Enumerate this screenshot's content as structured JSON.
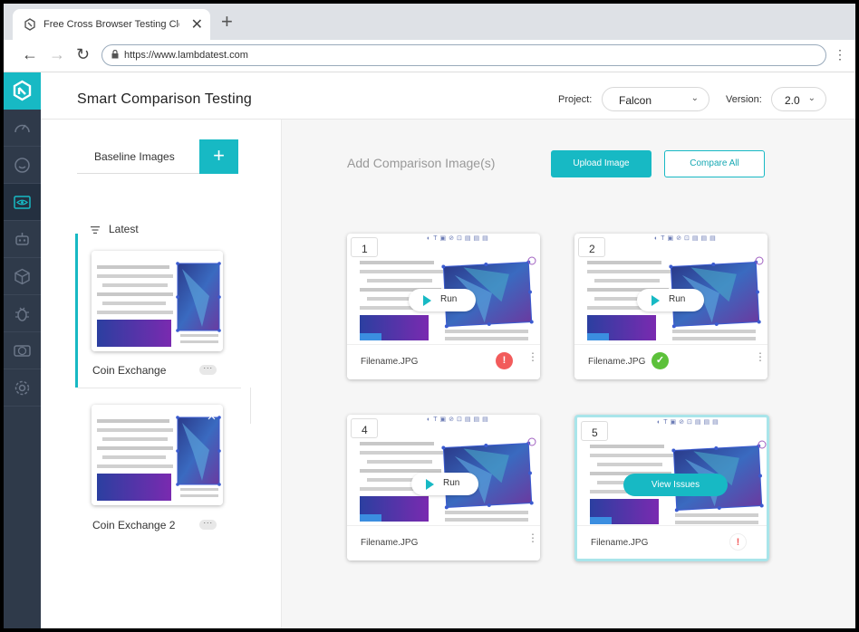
{
  "browser": {
    "tab_title": "Free Cross Browser Testing Clou",
    "tab_close": "✕",
    "new_tab": "+",
    "url": "https://www.lambdatest.com",
    "back": "←",
    "forward": "→",
    "reload": "↻",
    "menu": "⋮"
  },
  "header": {
    "title": "Smart Comparison Testing",
    "project_label": "Project:",
    "project_value": "Falcon",
    "version_label": "Version:",
    "version_value": "2.0",
    "chevron": "⌄"
  },
  "left_panel": {
    "baseline_label": "Baseline Images",
    "add_symbol": "+",
    "sort_label": "Latest",
    "items": [
      {
        "name": "Coin Exchange",
        "more": "···"
      },
      {
        "name": "Coin Exchange 2",
        "more": "···"
      }
    ]
  },
  "main": {
    "add_comparison_label": "Add Comparison Image(s)",
    "upload_label": "Upload Image",
    "compare_all_label": "Compare All",
    "cards": [
      {
        "number": "1",
        "filename": "Filename.JPG",
        "run_label": "Run",
        "status_symbol": "!",
        "status_color": "#f25b5b"
      },
      {
        "number": "2",
        "filename": "Filename.JPG",
        "run_label": "Run",
        "status_symbol": "✓",
        "status_color": "#5cc13a"
      },
      {
        "number": "4",
        "filename": "Filename.JPG",
        "run_label": "Run"
      },
      {
        "number": "5",
        "filename": "Filename.JPG",
        "view_label": "View Issues",
        "status_symbol": "!",
        "status_color": "#f25b5b"
      }
    ],
    "kebab": "⋮"
  },
  "colors": {
    "accent": "#17b9c4",
    "sidebar": "#2f3a4a",
    "error": "#f25b5b",
    "success": "#5cc13a"
  },
  "icons": {
    "sidebar": [
      "logo-icon",
      "speedometer-icon",
      "smile-icon",
      "visual-eye-icon",
      "robot-icon",
      "cube-icon",
      "bug-icon",
      "compare-icon",
      "gear-icon"
    ]
  }
}
